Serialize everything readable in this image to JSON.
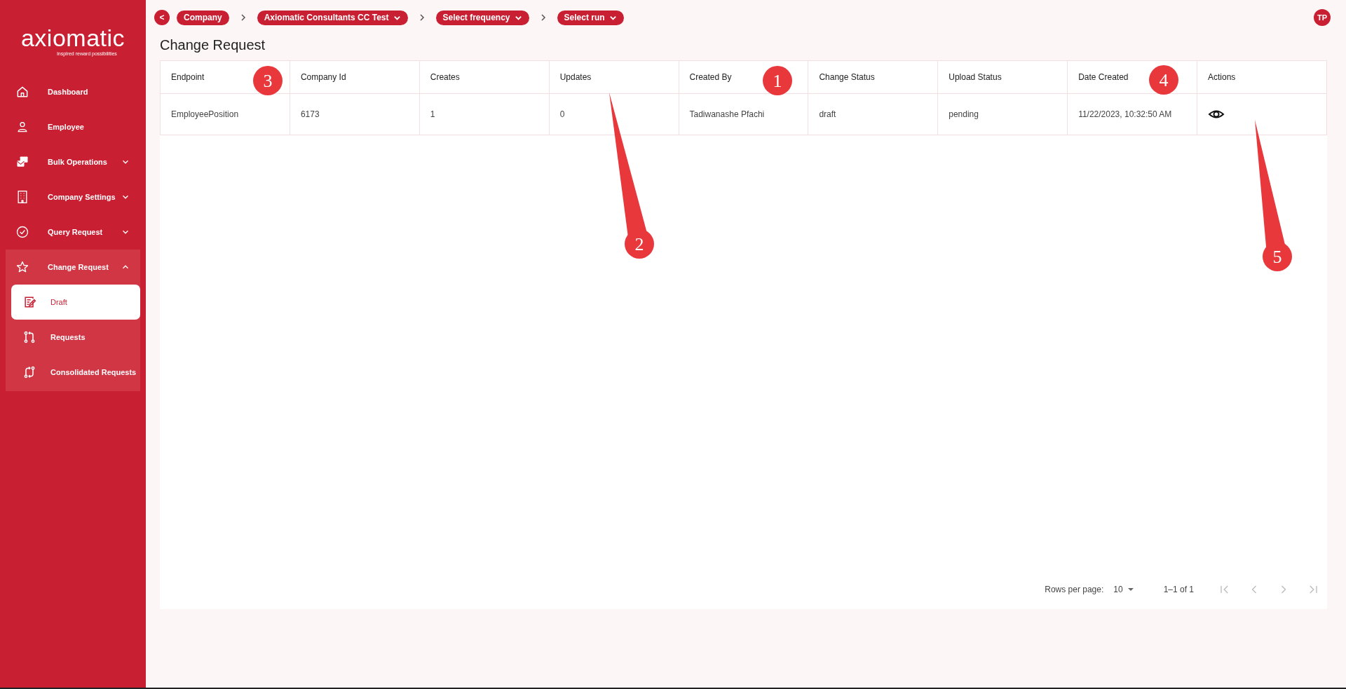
{
  "sidebar": {
    "logo": "axiomatic",
    "tagline": "inspired reward possibilities",
    "items": [
      {
        "label": "Dashboard"
      },
      {
        "label": "Employee"
      },
      {
        "label": "Bulk Operations",
        "expanded": false
      },
      {
        "label": "Company Settings",
        "expanded": false
      },
      {
        "label": "Query Request",
        "expanded": false
      },
      {
        "label": "Change Request",
        "expanded": true,
        "children": [
          {
            "label": "Draft",
            "selected": true
          },
          {
            "label": "Requests",
            "selected": false
          },
          {
            "label": "Consolidated Requests",
            "selected": false
          }
        ]
      }
    ]
  },
  "breadcrumb": {
    "back": "<",
    "items": [
      {
        "label": "Company",
        "dropdown": false
      },
      {
        "label": "Axiomatic Consultants CC Test",
        "dropdown": true
      },
      {
        "label": "Select frequency",
        "dropdown": true
      },
      {
        "label": "Select run",
        "dropdown": true
      }
    ]
  },
  "avatar": "TP",
  "title": "Change Request",
  "table": {
    "columns": [
      "Endpoint",
      "Company Id",
      "Creates",
      "Updates",
      "Created By",
      "Change Status",
      "Upload Status",
      "Date Created",
      "Actions"
    ],
    "rows": [
      [
        "EmployeePosition",
        "6173",
        "1",
        "0",
        "Tadiwanashe Pfachi",
        "draft",
        "pending",
        "11/22/2023, 10:32:50 AM"
      ]
    ]
  },
  "pagination": {
    "rows_per_page_label": "Rows per page:",
    "rows_per_page": "10",
    "range": "1–1 of 1"
  },
  "callouts": [
    "1",
    "2",
    "3",
    "4",
    "5"
  ]
}
